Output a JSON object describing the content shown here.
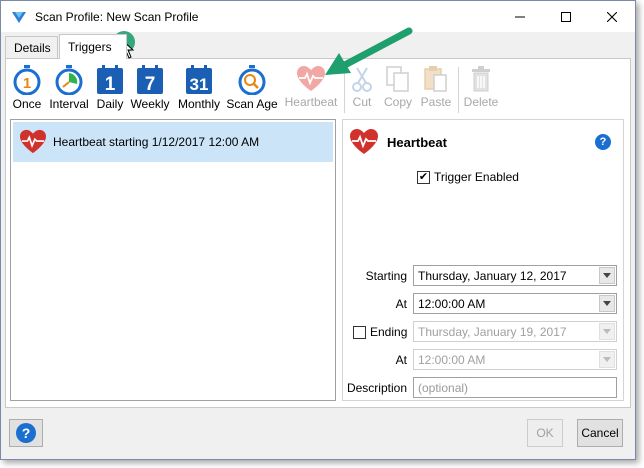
{
  "window": {
    "title": "Scan Profile: New Scan Profile"
  },
  "tabs": [
    {
      "label": "Details",
      "active": false
    },
    {
      "label": "Triggers",
      "active": true
    }
  ],
  "toolbar": {
    "once": "Once",
    "interval": "Interval",
    "daily": "Daily",
    "daily_num": "1",
    "weekly": "Weekly",
    "weekly_num": "7",
    "monthly": "Monthly",
    "monthly_num": "31",
    "scan_age": "Scan Age",
    "heartbeat": "Heartbeat",
    "cut": "Cut",
    "copy": "Copy",
    "paste": "Paste",
    "delete": "Delete"
  },
  "trigger_list": [
    {
      "label": "Heartbeat starting 1/12/2017 12:00 AM",
      "selected": true
    }
  ],
  "details": {
    "title": "Heartbeat",
    "help": "?",
    "trigger_enabled_label": "Trigger Enabled",
    "trigger_enabled": true,
    "starting_label": "Starting",
    "starting_value": "Thursday, January 12, 2017",
    "at_label": "At",
    "at_value": "12:00:00 AM",
    "ending_label": "Ending",
    "ending_checked": false,
    "ending_value": "Thursday, January 19, 2017",
    "at2_label": "At",
    "at2_value": "12:00:00 AM",
    "description_label": "Description",
    "description_placeholder": "(optional)"
  },
  "footer": {
    "help": "?",
    "ok": "OK",
    "cancel": "Cancel"
  },
  "colors": {
    "accent_blue": "#1a6fd0",
    "heart_red": "#d0312d",
    "selection": "#cce4f7",
    "callout_green": "#1f9e6e"
  }
}
